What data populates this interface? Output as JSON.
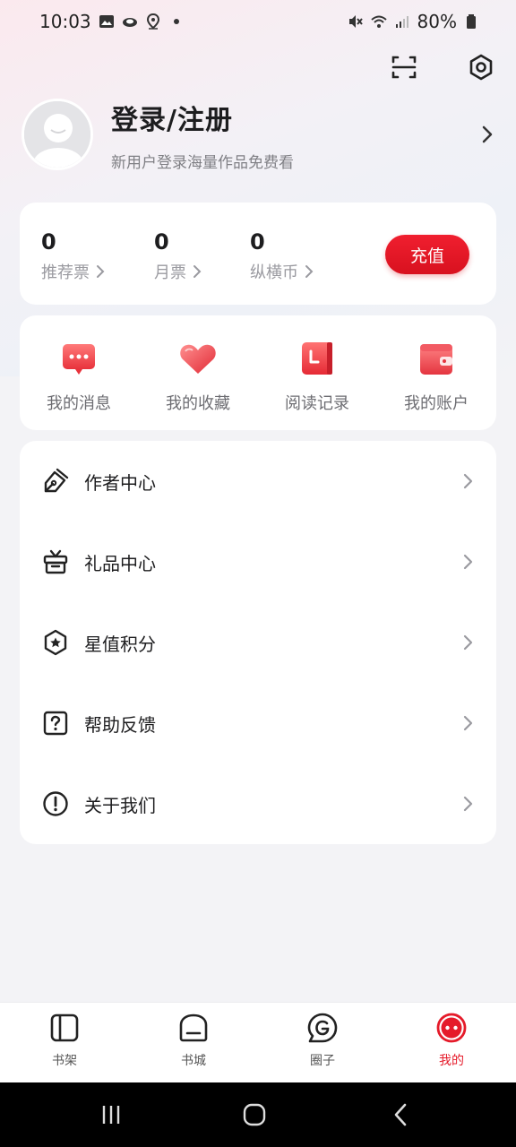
{
  "status_bar": {
    "time": "10:03",
    "battery": "80%",
    "icons_left": [
      "gallery-icon",
      "cloud-icon",
      "location-icon",
      "dot-icon"
    ],
    "icons_right": [
      "mute-icon",
      "wifi-icon",
      "signal-icon",
      "battery-icon"
    ]
  },
  "header": {
    "scan_icon": "scan-icon",
    "settings_icon": "settings-icon"
  },
  "profile": {
    "title": "登录/注册",
    "subtitle": "新用户登录海量作品免费看"
  },
  "stats": {
    "items": [
      {
        "value": "0",
        "label": "推荐票"
      },
      {
        "value": "0",
        "label": "月票"
      },
      {
        "value": "0",
        "label": "纵横币"
      }
    ],
    "recharge_label": "充值"
  },
  "quick_actions": [
    {
      "label": "我的消息",
      "icon": "message-icon"
    },
    {
      "label": "我的收藏",
      "icon": "heart-icon"
    },
    {
      "label": "阅读记录",
      "icon": "reading-record-icon"
    },
    {
      "label": "我的账户",
      "icon": "wallet-icon"
    }
  ],
  "menu": [
    {
      "label": "作者中心",
      "icon": "pen-icon"
    },
    {
      "label": "礼品中心",
      "icon": "gift-icon"
    },
    {
      "label": "星值积分",
      "icon": "star-hexagon-icon"
    },
    {
      "label": "帮助反馈",
      "icon": "help-icon"
    },
    {
      "label": "关于我们",
      "icon": "info-icon"
    }
  ],
  "tabs": [
    {
      "label": "书架",
      "icon": "bookshelf-icon",
      "active": false
    },
    {
      "label": "书城",
      "icon": "bookstore-icon",
      "active": false
    },
    {
      "label": "圈子",
      "icon": "circle-icon",
      "active": false
    },
    {
      "label": "我的",
      "icon": "me-icon",
      "active": true
    }
  ],
  "colors": {
    "accent": "#e51b2a",
    "background": "#f3f3f6",
    "card": "#ffffff"
  }
}
